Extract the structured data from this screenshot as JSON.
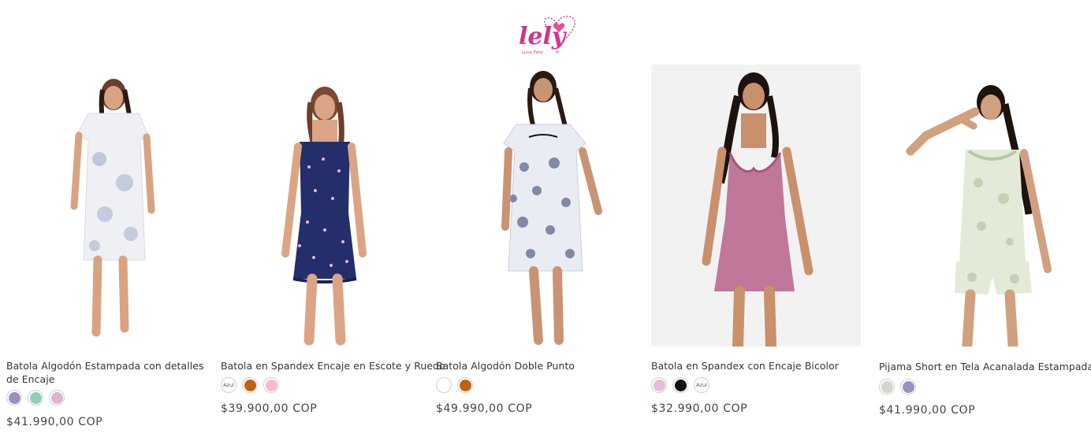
{
  "brand": {
    "logo_text": "lely",
    "tagline": "Luce Feliz",
    "registered": "®",
    "color": "#d6338a"
  },
  "products": [
    {
      "title": "Batola Algodón Estampada con detalles de Encaje",
      "price": "$41.990,00 COP",
      "garment_color": "#eef0f4",
      "pattern_color": "#9aa6c8",
      "garment": "nightgown-short-sleeve",
      "swatches": [
        {
          "color": "#9b8fbf",
          "label": ""
        },
        {
          "color": "#8fcfb8",
          "label": ""
        },
        {
          "color": "#dcb5d3",
          "label": ""
        }
      ]
    },
    {
      "title": "Batola en Spandex Encaje en Escote y Ruedo",
      "price": "$39.900,00 COP",
      "garment_color": "#242e6b",
      "pattern_color": "#e8b8c4",
      "garment": "slip-dress",
      "swatches": [
        {
          "color": "#ffffff",
          "label": "Azul"
        },
        {
          "color": "#c0620f",
          "label": ""
        },
        {
          "color": "#f6b9cf",
          "label": ""
        }
      ]
    },
    {
      "title": "Batola Algodón Doble Punto",
      "price": "$49.990,00 COP",
      "garment_color": "#e9edf3",
      "pattern_color": "#3d4a70",
      "garment": "nightgown-short-sleeve",
      "swatches": [
        {
          "color": "#ffffff",
          "label": ""
        },
        {
          "color": "#c0620f",
          "label": ""
        }
      ]
    },
    {
      "title": "Batola en Spandex con Encaje Bicolor",
      "price": "$32.990,00 COP",
      "garment_color": "#c0779a",
      "pattern_color": "#d08aa9",
      "garment": "slip-dress",
      "swatches": [
        {
          "color": "#e6bcd6",
          "label": ""
        },
        {
          "color": "#111111",
          "label": ""
        },
        {
          "color": "#ffffff",
          "label": "Azul"
        }
      ]
    },
    {
      "title": "Pijama Short en Tela Acanalada Estampada",
      "price": "$41.990,00 COP",
      "garment_color": "#e3ead8",
      "pattern_color": "#b7c6a6",
      "garment": "short-set",
      "swatches": [
        {
          "color": "#d2d7cc",
          "label": ""
        },
        {
          "color": "#9b8fbf",
          "label": ""
        }
      ]
    }
  ]
}
